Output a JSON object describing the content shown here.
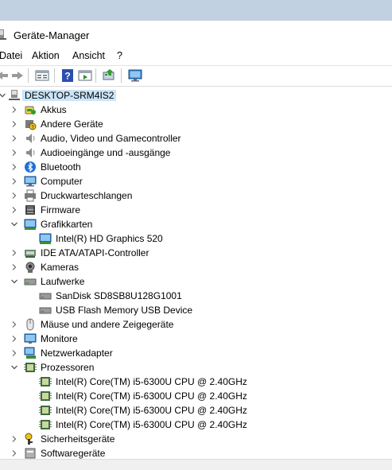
{
  "window": {
    "title": "Geräte-Manager"
  },
  "menu": [
    "Datei",
    "Aktion",
    "Ansicht",
    "?"
  ],
  "toolbar": [
    "back-arrow-icon",
    "forward-arrow-icon",
    "properties-icon",
    "help-icon",
    "view-icon",
    "update-driver-icon",
    "monitor-scan-icon"
  ],
  "tree": {
    "root": "DESKTOP-SRM4IS2",
    "items": [
      {
        "label": "Akkus",
        "icon": "battery-icon",
        "expanded": false
      },
      {
        "label": "Andere Geräte",
        "icon": "unknown-device-icon",
        "expanded": false
      },
      {
        "label": "Audio, Video und Gamecontroller",
        "icon": "speaker-icon",
        "expanded": false
      },
      {
        "label": "Audioeingänge und -ausgänge",
        "icon": "speaker-icon",
        "expanded": false
      },
      {
        "label": "Bluetooth",
        "icon": "bluetooth-icon",
        "expanded": false
      },
      {
        "label": "Computer",
        "icon": "computer-icon",
        "expanded": false
      },
      {
        "label": "Druckwarteschlangen",
        "icon": "printer-icon",
        "expanded": false
      },
      {
        "label": "Firmware",
        "icon": "firmware-icon",
        "expanded": false
      },
      {
        "label": "Grafikkarten",
        "icon": "display-adapter-icon",
        "expanded": true,
        "children": [
          {
            "label": "Intel(R) HD Graphics 520",
            "icon": "display-adapter-icon"
          }
        ]
      },
      {
        "label": "IDE ATA/ATAPI-Controller",
        "icon": "ide-controller-icon",
        "expanded": false
      },
      {
        "label": "Kameras",
        "icon": "camera-icon",
        "expanded": false
      },
      {
        "label": "Laufwerke",
        "icon": "drive-icon",
        "expanded": true,
        "children": [
          {
            "label": "SanDisk SD8SB8U128G1001",
            "icon": "drive-icon"
          },
          {
            "label": "USB Flash Memory USB Device",
            "icon": "drive-icon"
          }
        ]
      },
      {
        "label": "Mäuse und andere Zeigegeräte",
        "icon": "mouse-icon",
        "expanded": false
      },
      {
        "label": "Monitore",
        "icon": "monitor-icon",
        "expanded": false
      },
      {
        "label": "Netzwerkadapter",
        "icon": "network-adapter-icon",
        "expanded": false
      },
      {
        "label": "Prozessoren",
        "icon": "processor-icon",
        "expanded": true,
        "children": [
          {
            "label": "Intel(R) Core(TM) i5-6300U CPU @ 2.40GHz",
            "icon": "processor-icon"
          },
          {
            "label": "Intel(R) Core(TM) i5-6300U CPU @ 2.40GHz",
            "icon": "processor-icon"
          },
          {
            "label": "Intel(R) Core(TM) i5-6300U CPU @ 2.40GHz",
            "icon": "processor-icon"
          },
          {
            "label": "Intel(R) Core(TM) i5-6300U CPU @ 2.40GHz",
            "icon": "processor-icon"
          }
        ]
      },
      {
        "label": "Sicherheitsgeräte",
        "icon": "security-key-icon",
        "expanded": false
      },
      {
        "label": "Softwaregeräte",
        "icon": "software-device-icon",
        "expanded": false
      }
    ]
  },
  "colors": {
    "root_selection": "#cce4f7",
    "title_strip": "#c2d1e1"
  }
}
